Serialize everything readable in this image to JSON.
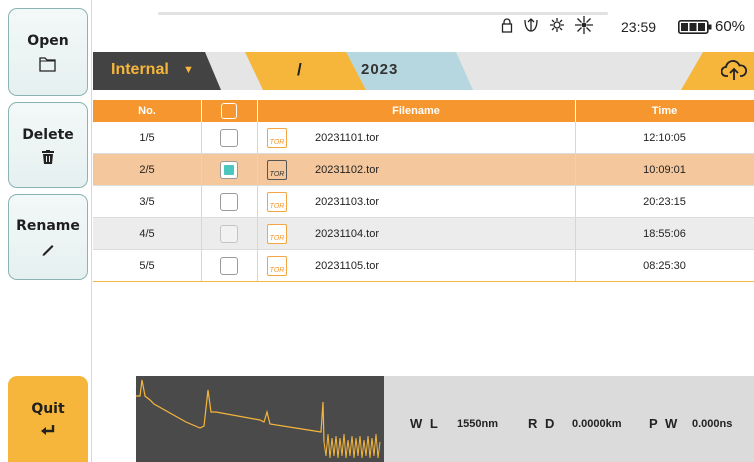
{
  "sidebar": {
    "open_label": "Open",
    "delete_label": "Delete",
    "rename_label": "Rename",
    "quit_label": "Quit"
  },
  "status": {
    "time": "23:59",
    "battery_percent": "60%",
    "icons": [
      "lock-icon",
      "usb-icon",
      "settings-sun-icon",
      "brightness-icon",
      "battery-icon"
    ]
  },
  "path": {
    "storage": "Internal",
    "root": "/",
    "folder": "2023"
  },
  "table": {
    "headers": {
      "no": "No.",
      "filename": "Filename",
      "time": "Time"
    },
    "rows": [
      {
        "no": "1/5",
        "checked": false,
        "filename": "20231101.tor",
        "time": "12:10:05"
      },
      {
        "no": "2/5",
        "checked": true,
        "filename": "20231102.tor",
        "time": "10:09:01"
      },
      {
        "no": "3/5",
        "checked": false,
        "filename": "20231103.tor",
        "time": "20:23:15"
      },
      {
        "no": "4/5",
        "checked": false,
        "filename": "20231104.tor",
        "time": "18:55:06"
      },
      {
        "no": "5/5",
        "checked": false,
        "filename": "20231105.tor",
        "time": "08:25:30"
      }
    ],
    "file_icon_text": "TOR"
  },
  "info": {
    "wl_label": "W L",
    "wl_value": "1550nm",
    "rd_label": "R D",
    "rd_value": "0.0000km",
    "pw_label": "P W",
    "pw_value": "0.000ns"
  },
  "colors": {
    "accent_orange": "#f6b63b",
    "header_orange": "#f6962e",
    "selected_row": "#f4c79c",
    "folder_blue": "#b7d7e0",
    "check_teal": "#4bc7c0",
    "trace_bg": "#4a4a4a"
  }
}
